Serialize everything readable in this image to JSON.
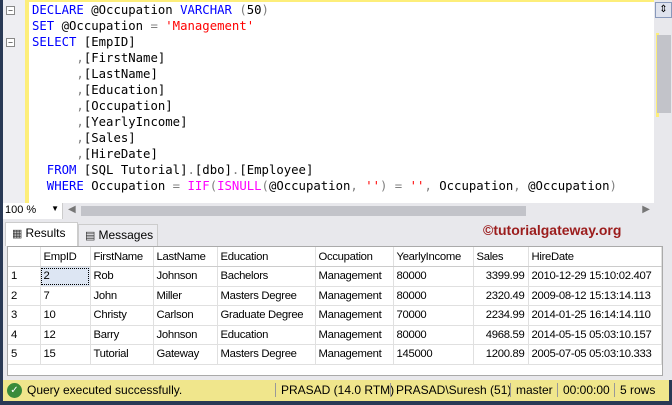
{
  "editor": {
    "lines": [
      [
        [
          "kw",
          "DECLARE"
        ],
        [
          "",
          "@Occupation "
        ],
        [
          "kw",
          "VARCHAR"
        ],
        [
          "gray",
          "("
        ],
        [
          "",
          "50"
        ],
        [
          "gray",
          ")"
        ]
      ],
      [
        [
          "kw",
          "SET"
        ],
        [
          "",
          "@Occupation "
        ],
        [
          "gray",
          "= "
        ],
        [
          "str",
          "'Management'"
        ]
      ],
      [
        [
          "kw",
          "SELECT"
        ],
        [
          "",
          "[EmpID]"
        ]
      ],
      [
        [
          "gray",
          "      ,"
        ],
        [
          "",
          "[FirstName]"
        ]
      ],
      [
        [
          "gray",
          "      ,"
        ],
        [
          "",
          "[LastName]"
        ]
      ],
      [
        [
          "gray",
          "      ,"
        ],
        [
          "",
          "[Education]"
        ]
      ],
      [
        [
          "gray",
          "      ,"
        ],
        [
          "",
          "[Occupation]"
        ]
      ],
      [
        [
          "gray",
          "      ,"
        ],
        [
          "",
          "[YearlyIncome]"
        ]
      ],
      [
        [
          "gray",
          "      ,"
        ],
        [
          "",
          "[Sales]"
        ]
      ],
      [
        [
          "gray",
          "      ,"
        ],
        [
          "",
          "[HireDate]"
        ]
      ],
      [
        [
          "kw",
          "  FROM"
        ],
        [
          "",
          "[SQL Tutorial]"
        ],
        [
          "gray",
          "."
        ],
        [
          "",
          "[dbo]"
        ],
        [
          "gray",
          "."
        ],
        [
          "",
          "[Employee]"
        ]
      ],
      [
        [
          "kw",
          "  WHERE"
        ],
        [
          "",
          "Occupation "
        ],
        [
          "gray",
          "= "
        ],
        [
          "fn",
          "IIF"
        ],
        [
          "gray",
          "("
        ],
        [
          "fn",
          "ISNULL"
        ],
        [
          "gray",
          "("
        ],
        [
          "",
          "@Occupation"
        ],
        [
          "gray",
          ", "
        ],
        [
          "str",
          "''"
        ],
        [
          "gray",
          ") = "
        ],
        [
          "str",
          "''"
        ],
        [
          "gray",
          ", "
        ],
        [
          "",
          "Occupation"
        ],
        [
          "gray",
          ", "
        ],
        [
          "",
          "@Occupation"
        ],
        [
          "gray",
          ")"
        ]
      ]
    ]
  },
  "zoom": "100 %",
  "tabs": {
    "results": "Results",
    "messages": "Messages"
  },
  "watermark": "©tutorialgateway.org",
  "grid": {
    "columns": [
      "",
      "EmpID",
      "FirstName",
      "LastName",
      "Education",
      "Occupation",
      "YearlyIncome",
      "Sales",
      "HireDate"
    ],
    "rows": [
      [
        "1",
        "2",
        "Rob",
        "Johnson",
        "Bachelors",
        "Management",
        "80000",
        "3399.99",
        "2010-12-29 15:10:02.407"
      ],
      [
        "2",
        "7",
        "John",
        "Miller",
        "Masters Degree",
        "Management",
        "80000",
        "2320.49",
        "2009-08-12 15:13:14.113"
      ],
      [
        "3",
        "10",
        "Christy",
        "Carlson",
        "Graduate Degree",
        "Management",
        "70000",
        "2234.99",
        "2014-01-25 16:14:14.110"
      ],
      [
        "4",
        "12",
        "Barry",
        "Johnson",
        "Education",
        "Management",
        "80000",
        "4968.59",
        "2014-05-15 05:03:10.157"
      ],
      [
        "5",
        "15",
        "Tutorial",
        "Gateway",
        "Masters Degree",
        "Management",
        "145000",
        "1200.89",
        "2005-07-05 05:03:10.333"
      ]
    ]
  },
  "status": {
    "message": "Query executed successfully.",
    "server": "PRASAD (14.0 RTM)",
    "user": "PRASAD\\Suresh (51)",
    "database": "master",
    "elapsed": "00:00:00",
    "rows": "5 rows"
  }
}
